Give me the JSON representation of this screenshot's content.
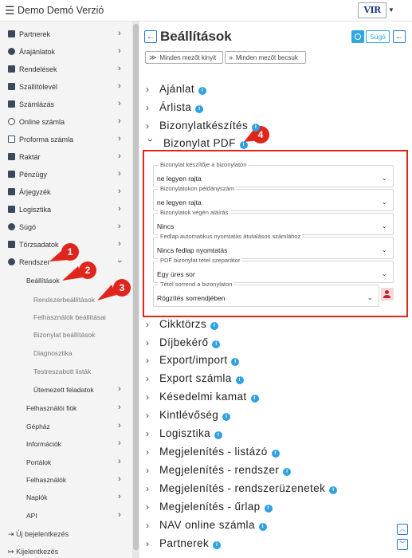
{
  "header": {
    "app_title": "Demo Demó Verzió",
    "logo_text": "VIR"
  },
  "sidebar": {
    "items": [
      {
        "label": "Partnerek"
      },
      {
        "label": "Árajánlatok"
      },
      {
        "label": "Rendelések"
      },
      {
        "label": "Szállítólevél"
      },
      {
        "label": "Számlázás"
      },
      {
        "label": "Online számla"
      },
      {
        "label": "Proforma számla"
      },
      {
        "label": "Raktár"
      },
      {
        "label": "Pénzügy"
      },
      {
        "label": "Árjegyzék"
      },
      {
        "label": "Logisztika"
      },
      {
        "label": "Súgó"
      },
      {
        "label": "Törzsadatok"
      },
      {
        "label": "Rendszer"
      }
    ],
    "rendszer_sub": {
      "beallitasok": "Beállítások",
      "beallitasok_children": [
        "Rendszerbeállítások",
        "Felhasználók beállításai",
        "Bizonylat beállítások",
        "Diagnosztika",
        "Testreszabott listák",
        "Ütemezett feladatok"
      ],
      "others": [
        "Felhasználói fiók",
        "Gépház",
        "Információk",
        "Portálok",
        "Felhasználók",
        "Naplók",
        "API"
      ]
    },
    "footer": {
      "new_login": "Új bejelentkezés",
      "logout": "Kijelentkezés"
    }
  },
  "callouts": [
    "1",
    "2",
    "3",
    "4"
  ],
  "main": {
    "title": "Beállítások",
    "help_label": "Súgó",
    "expand_all": "Minden mezőt kinyit",
    "collapse_all": "Minden mezőt becsuk",
    "sections_before": [
      "Ajánlat",
      "Árlista",
      "Bizonylatkészítés"
    ],
    "open_section": "Bizonylat PDF",
    "fields": [
      {
        "label": "Bizonylat készítője a bizonylaton",
        "value": "ne legyen rajta"
      },
      {
        "label": "Bizonylatokon példányszám",
        "value": "ne legyen rajta"
      },
      {
        "label": "Bizonylatok végén aláírás",
        "value": "Nincs"
      },
      {
        "label": "Fedlap automatikus nyomtatás átutalásos számlához",
        "value": "Nincs fedlap nyomtatás"
      },
      {
        "label": "PDF bizonylat tétel szeparátor",
        "value": "Egy üres sor"
      },
      {
        "label": "Tétel sorrend a bizonylaton",
        "value": "Rögzítés sorrendjében"
      }
    ],
    "sections_after": [
      "Cikktörzs",
      "Díjbekérő",
      "Export/import",
      "Export számla",
      "Késedelmi kamat",
      "Kintlévőség",
      "Logisztika",
      "Megjelenítés - listázó",
      "Megjelenítés - rendszer",
      "Megjelenítés - rendszerüzenetek",
      "Megjelenítés - űrlap",
      "NAV online számla",
      "Partnerek"
    ]
  }
}
